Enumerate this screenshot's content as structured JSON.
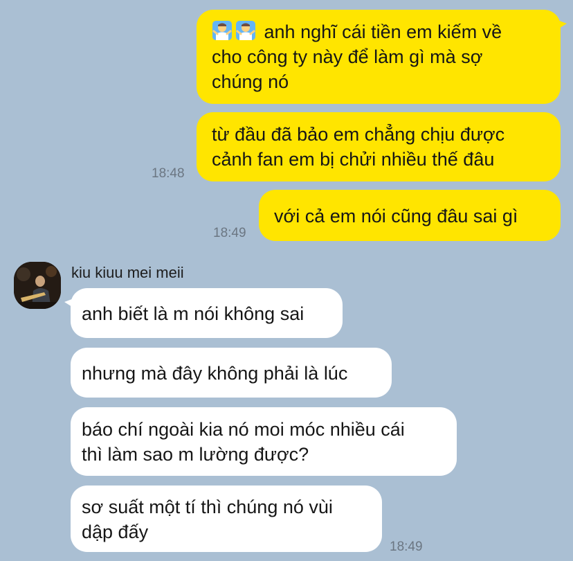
{
  "messages_outgoing": [
    {
      "emoji": [
        "person-shrugging-icon",
        "person-shrugging-icon"
      ],
      "lines": [
        "anh nghĩ cái tiền em kiếm về",
        "cho công ty này để làm gì mà sợ",
        "chúng nó"
      ]
    },
    {
      "lines": [
        "từ đầu đã bảo em chẳng chịu được",
        "cảnh fan em bị chửi nhiều thế đâu"
      ],
      "time": "18:48"
    },
    {
      "lines": [
        "với cả em nói cũng đâu sai gì"
      ],
      "time": "18:49"
    }
  ],
  "contact": {
    "name": "kiu kiuu mei meii"
  },
  "messages_incoming": [
    {
      "lines": [
        "anh biết là m nói không sai"
      ]
    },
    {
      "lines": [
        "nhưng mà đây không phải là lúc"
      ]
    },
    {
      "lines": [
        "báo chí ngoài kia nó moi móc nhiều cái",
        "thì làm sao m lường được?"
      ]
    },
    {
      "lines": [
        "sơ suất một tí thì chúng nó vùi",
        "dập đấy"
      ],
      "time": "18:49"
    }
  ],
  "colors": {
    "background": "#aabfd3",
    "outgoing_bubble": "#ffe500",
    "incoming_bubble": "#ffffff"
  }
}
